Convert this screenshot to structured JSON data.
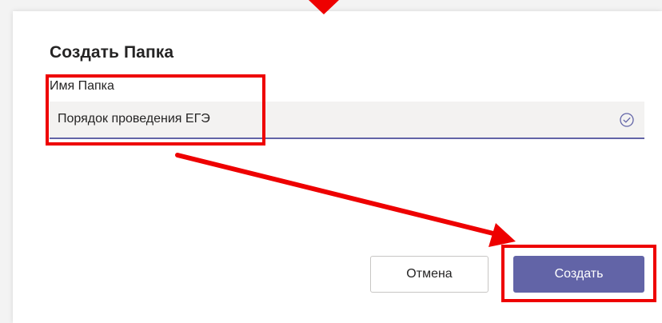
{
  "dialog": {
    "title": "Создать Папка",
    "field_label": "Имя Папка",
    "field_value": "Порядок проведения ЕГЭ",
    "cancel_label": "Отмена",
    "create_label": "Создать",
    "validation_icon": "check-circle-icon"
  },
  "colors": {
    "accent": "#6264a7",
    "annotation": "#ee0000",
    "input_background": "#f3f2f1"
  }
}
